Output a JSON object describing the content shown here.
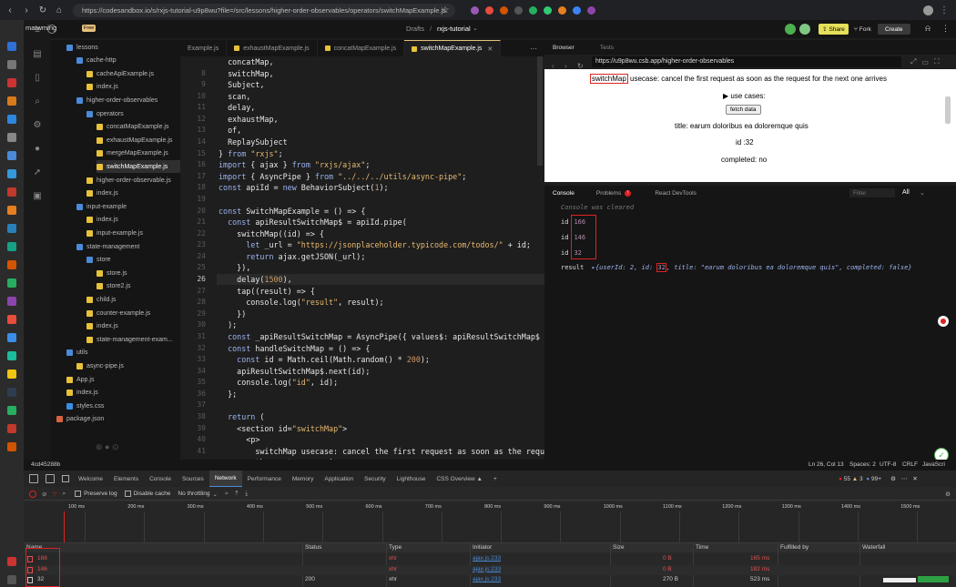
{
  "browser": {
    "url": "https://codesandbox.io/s/rxjs-tutorial-u9p8wu?file=/src/lessons/higher-order-observables/operators/switchMapExample.js",
    "ext_colors": [
      "#9b59b6",
      "#e74c3c",
      "#d35400",
      "#555555",
      "#27ae60",
      "#2ecc71",
      "#e67e22",
      "#3b82f6",
      "#8e44ad"
    ]
  },
  "topbar": {
    "workspace": "matwming",
    "plan_badge": "Free",
    "breadcrumb_parent": "Drafts",
    "breadcrumb_sep": "/",
    "project": "rxjs-tutorial",
    "share_label": "Share",
    "fork_label": "Fork",
    "create_label": "Create"
  },
  "explorer": {
    "items": [
      {
        "label": "lessons",
        "type": "folder",
        "indent": 1
      },
      {
        "label": "cache-http",
        "type": "folder",
        "indent": 2
      },
      {
        "label": "cacheApiExample.js",
        "type": "js",
        "indent": 3
      },
      {
        "label": "index.js",
        "type": "js",
        "indent": 3
      },
      {
        "label": "higher-order-observables",
        "type": "folder",
        "indent": 2
      },
      {
        "label": "operators",
        "type": "folder",
        "indent": 3
      },
      {
        "label": "concatMapExample.js",
        "type": "js",
        "indent": 4
      },
      {
        "label": "exhaustMapExample.js",
        "type": "js",
        "indent": 4
      },
      {
        "label": "mergeMapExample.js",
        "type": "js",
        "indent": 4
      },
      {
        "label": "switchMapExample.js",
        "type": "js",
        "indent": 4,
        "active": true
      },
      {
        "label": "higher-order-observable.js",
        "type": "js",
        "indent": 3
      },
      {
        "label": "index.js",
        "type": "js",
        "indent": 3
      },
      {
        "label": "input-example",
        "type": "folder",
        "indent": 2
      },
      {
        "label": "index.js",
        "type": "js",
        "indent": 3
      },
      {
        "label": "input-example.js",
        "type": "js",
        "indent": 3
      },
      {
        "label": "state-management",
        "type": "folder",
        "indent": 2
      },
      {
        "label": "store",
        "type": "folder",
        "indent": 3
      },
      {
        "label": "store.js",
        "type": "js",
        "indent": 4
      },
      {
        "label": "store2.js",
        "type": "js",
        "indent": 4
      },
      {
        "label": "child.js",
        "type": "js",
        "indent": 3
      },
      {
        "label": "counter-example.js",
        "type": "js",
        "indent": 3
      },
      {
        "label": "index.js",
        "type": "js",
        "indent": 3
      },
      {
        "label": "state-management-exam...",
        "type": "js",
        "indent": 3
      },
      {
        "label": "utils",
        "type": "folder",
        "indent": 1
      },
      {
        "label": "async-pipe.js",
        "type": "js",
        "indent": 2
      },
      {
        "label": "App.js",
        "type": "js",
        "indent": 1
      },
      {
        "label": "index.js",
        "type": "js",
        "indent": 1
      },
      {
        "label": "styles.css",
        "type": "css",
        "indent": 1
      },
      {
        "label": "package.json",
        "type": "json",
        "indent": 0
      }
    ]
  },
  "editor": {
    "tabs": [
      {
        "label": "Example.js",
        "active": false
      },
      {
        "label": "exhaustMapExample.js",
        "active": false
      },
      {
        "label": "concatMapExample.js",
        "active": false
      },
      {
        "label": "switchMapExample.js",
        "active": true
      }
    ],
    "close_glyph": "✕",
    "active_line": 26,
    "lines": [
      {
        "n": "",
        "t": "  concatMap,"
      },
      {
        "n": "8",
        "t": "  switchMap,"
      },
      {
        "n": "9",
        "t": "  Subject,"
      },
      {
        "n": "10",
        "t": "  scan,"
      },
      {
        "n": "11",
        "t": "  delay,"
      },
      {
        "n": "12",
        "t": "  exhaustMap,"
      },
      {
        "n": "13",
        "t": "  of,"
      },
      {
        "n": "14",
        "t": "  ReplaySubject"
      },
      {
        "n": "15",
        "t": "} from \"rxjs\";"
      },
      {
        "n": "16",
        "t": "import { ajax } from \"rxjs/ajax\";"
      },
      {
        "n": "17",
        "t": "import { AsyncPipe } from \"../../../utils/async-pipe\";"
      },
      {
        "n": "18",
        "t": "const apiId = new BehaviorSubject(1);"
      },
      {
        "n": "19",
        "t": ""
      },
      {
        "n": "20",
        "t": "const SwitchMapExample = () => {"
      },
      {
        "n": "21",
        "t": "  const apiResultSwitchMap$ = apiId.pipe("
      },
      {
        "n": "22",
        "t": "    switchMap((id) => {"
      },
      {
        "n": "23",
        "t": "      let _url = \"https://jsonplaceholder.typicode.com/todos/\" + id;"
      },
      {
        "n": "24",
        "t": "      return ajax.getJSON(_url);"
      },
      {
        "n": "25",
        "t": "    }),"
      },
      {
        "n": "26",
        "t": "    delay(1500),"
      },
      {
        "n": "27",
        "t": "    tap((result) => {"
      },
      {
        "n": "28",
        "t": "      console.log(\"result\", result);"
      },
      {
        "n": "29",
        "t": "    })"
      },
      {
        "n": "30",
        "t": "  );"
      },
      {
        "n": "31",
        "t": "  const _apiResultSwitchMap = AsyncPipe({ values$: apiResultSwitchMap$"
      },
      {
        "n": "32",
        "t": "  const handleSwitchMap = () => {"
      },
      {
        "n": "33",
        "t": "    const id = Math.ceil(Math.random() * 200);"
      },
      {
        "n": "34",
        "t": "    apiResultSwitchMap$.next(id);"
      },
      {
        "n": "35",
        "t": "    console.log(\"id\", id);"
      },
      {
        "n": "36",
        "t": "  };"
      },
      {
        "n": "37",
        "t": ""
      },
      {
        "n": "38",
        "t": "  return ("
      },
      {
        "n": "39",
        "t": "    <section id=\"switchMap\">"
      },
      {
        "n": "40",
        "t": "      <p>"
      },
      {
        "n": "41",
        "t": "        switchMap usecase: cancel the first request as soon as the requ"
      },
      {
        "n": "",
        "t": "        the next one arrives"
      }
    ]
  },
  "preview": {
    "tab_browser": "Browser",
    "tab_tests": "Tests",
    "url": "https://u9p8wu.csb.app/higher-order-observables",
    "highlight_word": "switchMap",
    "usecase_text": " usecase: cancel the first request as soon as the request for the next one arrives",
    "use_cases": "▶ use cases:",
    "fetch_button": "fetch data",
    "title_line": "title: earum doloribus ea doloremque quis",
    "id_line": "id :32",
    "completed_line": "completed: no"
  },
  "console": {
    "tab_console": "Console",
    "tab_problems": "Problems",
    "problems_count": "!",
    "tab_react": "React DevTools",
    "filter_placeholder": "Filter",
    "level": "All",
    "cleared": "Console was cleared",
    "ids": [
      {
        "label": "id",
        "value": "166"
      },
      {
        "label": "id",
        "value": "146"
      },
      {
        "label": "id",
        "value": "32"
      }
    ],
    "result_label": "result",
    "result_obj_pre": "▸{userId: 2, id: ",
    "result_id": "32",
    "result_obj_post": ", title: \"earum doloribus ea doloremque quis\", completed: false}"
  },
  "status": {
    "commit": "4cd45288b",
    "position": "Ln 26, Col 13",
    "spaces": "Spaces: 2",
    "encoding": "UTF-8",
    "eol": "CRLF",
    "lang": "JavaScri"
  },
  "devtools": {
    "tabs": [
      "Welcome",
      "Elements",
      "Console",
      "Sources",
      "Network",
      "Performance",
      "Memory",
      "Application",
      "Security",
      "Lighthouse",
      "CSS Overview ▲"
    ],
    "active_tab": "Network",
    "errors": "55",
    "warnings": "3",
    "info": "99+",
    "preserve_log": "Preserve log",
    "disable_cache": "Disable cache",
    "throttling": "No throttling",
    "ticks": [
      "100 ms",
      "200 ms",
      "300 ms",
      "400 ms",
      "500 ms",
      "600 ms",
      "700 ms",
      "800 ms",
      "900 ms",
      "1000 ms",
      "1100 ms",
      "1200 ms",
      "1300 ms",
      "1400 ms",
      "1500 ms"
    ],
    "columns": [
      "Name",
      "Status",
      "Type",
      "Initiator",
      "Size",
      "Time",
      "Fulfilled by",
      "Waterfall"
    ],
    "rows": [
      {
        "name": "166",
        "status": "",
        "type": "xhr",
        "initiator": "ajax.js:233",
        "size": "0 B",
        "time": "165 ms",
        "error": true
      },
      {
        "name": "146",
        "status": "",
        "type": "xhr",
        "initiator": "ajax.js:233",
        "size": "0 B",
        "time": "182 ms",
        "error": true
      },
      {
        "name": "32",
        "status": "200",
        "type": "xhr",
        "initiator": "ajax.js:233",
        "size": "270 B",
        "time": "523 ms",
        "error": false
      }
    ]
  },
  "colors": {
    "accent_yellow": "#e5c07b",
    "error_red": "#d22",
    "highlight": "#d22222",
    "keyword": "#9cb4f0",
    "string": "#e8b96e"
  }
}
